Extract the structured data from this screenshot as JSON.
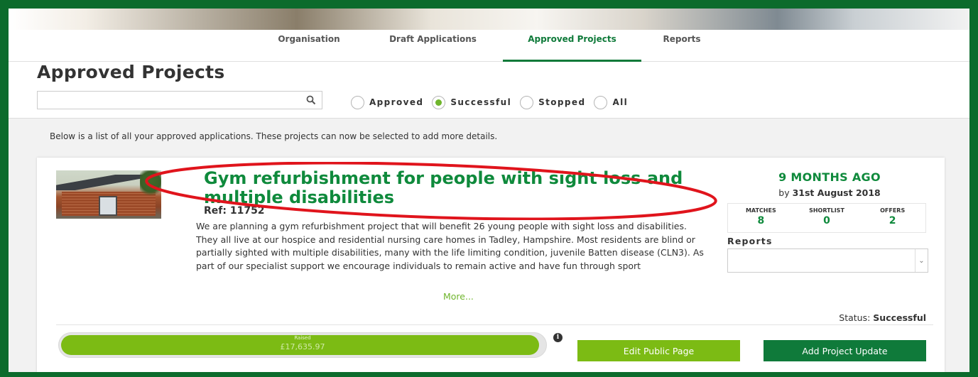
{
  "nav": {
    "tabs": [
      {
        "label": "Organisation",
        "active": false
      },
      {
        "label": "Draft Applications",
        "active": false
      },
      {
        "label": "Approved Projects",
        "active": true
      },
      {
        "label": "Reports",
        "active": false
      }
    ]
  },
  "header": {
    "title": "Approved Projects",
    "search": {
      "value": "",
      "placeholder": ""
    }
  },
  "filters": {
    "options": [
      {
        "label": "Approved",
        "checked": false
      },
      {
        "label": "Successful",
        "checked": true
      },
      {
        "label": "Stopped",
        "checked": false
      },
      {
        "label": "All",
        "checked": false
      }
    ]
  },
  "intro_text": "Below is a list of all your approved applications. These projects can now be selected to add more details.",
  "project": {
    "title": "Gym refurbishment for people with sight loss and multiple disabilities",
    "ref": "Ref: 11752",
    "description": "We are planning a gym refurbishment project that will benefit 26 young people with sight loss and disabilities. They all live at our hospice and residential nursing care homes in Tadley, Hampshire. Most residents are blind or partially sighted with multiple disabilities, many with the life limiting condition, juvenile Batten disease (CLN3). As part of our specialist support we encourage individuals to remain active and have fun through sport",
    "more_label": "More...",
    "time_ago": "9 MONTHS AGO",
    "deadline_prefix": "by",
    "deadline_date": "31st August 2018",
    "stats": [
      {
        "label": "MATCHES",
        "value": "8"
      },
      {
        "label": "SHORTLIST",
        "value": "0"
      },
      {
        "label": "OFFERS",
        "value": "2"
      }
    ],
    "reports_label": "Reports",
    "reports_selected": "",
    "status_label": "Status:",
    "status_value": "Successful",
    "raised_label": "Raised",
    "raised_amount": "£17,635.97",
    "progress_fraction": 0.99,
    "edit_button": "Edit Public Page",
    "update_button": "Add Project Update"
  },
  "colors": {
    "frame": "#0c6b2c",
    "brand_green": "#0f8a3c",
    "accent_green": "#7cbb14",
    "highlight_ellipse": "#e0141c"
  }
}
